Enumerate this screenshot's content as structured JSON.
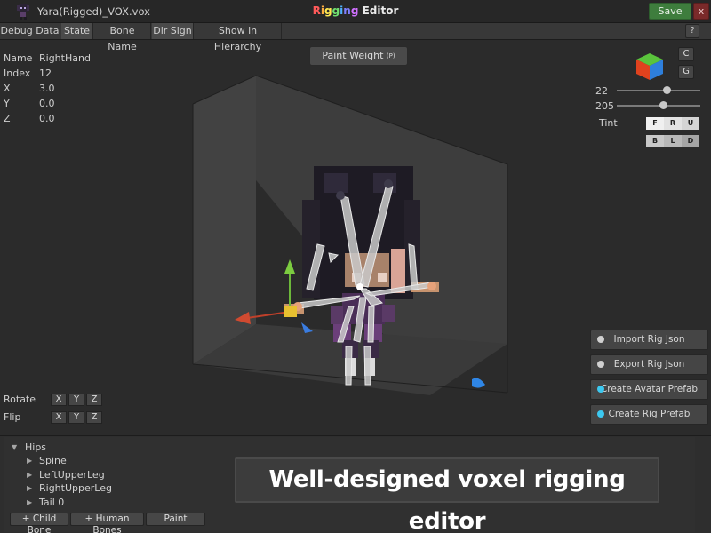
{
  "window": {
    "file_name": "Yara(Rigged)_VOX.vox",
    "title_letters": [
      "R",
      "i",
      "g",
      "g",
      "i",
      "n",
      "g"
    ],
    "title_rest": " Editor",
    "title_colors": [
      "#ff5a5a",
      "#ffb040",
      "#ffe850",
      "#70e070",
      "#50b0ff",
      "#8080ff",
      "#d070ff"
    ],
    "save_label": "Save",
    "close_label": "x"
  },
  "tabs": [
    {
      "label": "Debug Data",
      "active": false
    },
    {
      "label": "State",
      "active": true
    },
    {
      "label": "Bone Name",
      "active": false
    },
    {
      "label": "Dir Sign",
      "active": true
    },
    {
      "label": "Show in Hierarchy",
      "active": false
    }
  ],
  "help_label": "?",
  "bone_info": [
    {
      "key": "Name",
      "value": "RightHand"
    },
    {
      "key": "Index",
      "value": "12"
    },
    {
      "key": "X",
      "value": "3.0"
    },
    {
      "key": "Y",
      "value": "0.0"
    },
    {
      "key": "Z",
      "value": "0.0"
    }
  ],
  "paint_weight": {
    "label": "Paint Weight",
    "shortcut": "(P)"
  },
  "view": {
    "c_label": "C",
    "g_label": "G"
  },
  "sliders": [
    {
      "label": "22",
      "fraction": 0.6
    },
    {
      "label": "205",
      "fraction": 0.55
    }
  ],
  "tint": {
    "label": "Tint",
    "row1": [
      "F",
      "R",
      "U"
    ],
    "row2": [
      "B",
      "L",
      "D"
    ]
  },
  "rotate": {
    "label": "Rotate",
    "axes": [
      "X",
      "Y",
      "Z"
    ]
  },
  "flip": {
    "label": "Flip",
    "axes": [
      "X",
      "Y",
      "Z"
    ]
  },
  "actions": [
    {
      "label": "Import Rig Json",
      "dot": "#d0d0d0"
    },
    {
      "label": "Export Rig Json",
      "dot": "#d0d0d0"
    },
    {
      "label": "Create Avatar Prefab",
      "dot": "#3cc8f0"
    },
    {
      "label": "Create Rig Prefab",
      "dot": "#3cc8f0"
    }
  ],
  "hierarchy": {
    "root": "Hips",
    "children": [
      "Spine",
      "LeftUpperLeg",
      "RightUpperLeg",
      "Tail 0"
    ]
  },
  "bottom_buttons": [
    "+ Child Bone",
    "+ Human Bones",
    "Paint"
  ],
  "caption": "Well-designed voxel rigging editor"
}
